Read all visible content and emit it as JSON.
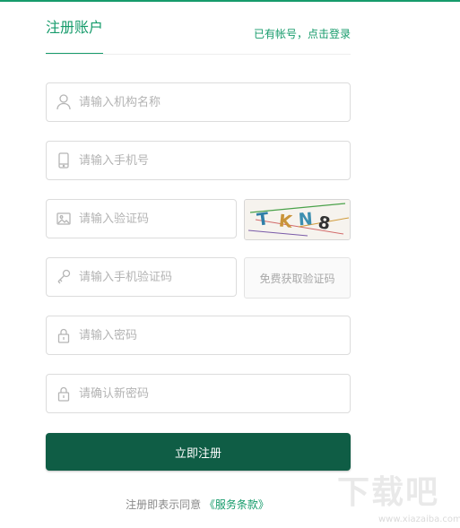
{
  "header": {
    "tab_title": "注册账户",
    "login_link": "已有帐号，点击登录"
  },
  "form": {
    "org_name": {
      "placeholder": "请输入机构名称",
      "icon": "user-icon"
    },
    "phone": {
      "placeholder": "请输入手机号",
      "icon": "phone-icon"
    },
    "captcha": {
      "placeholder": "请输入验证码",
      "icon": "image-icon",
      "image_text": "TKN8"
    },
    "sms_code": {
      "placeholder": "请输入手机验证码",
      "icon": "key-icon",
      "button_label": "免费获取验证码"
    },
    "password": {
      "placeholder": "请输入密码",
      "icon": "lock-icon"
    },
    "password_confirm": {
      "placeholder": "请确认新密码",
      "icon": "lock-icon"
    },
    "submit_label": "立即注册"
  },
  "terms": {
    "prefix": "注册即表示同意",
    "link": "《服务条款》"
  },
  "watermark": {
    "main": "下载吧",
    "url": "www.xiazaiba.com"
  },
  "colors": {
    "accent": "#169b6b",
    "submit_bg": "#0f5d45",
    "border": "#dcdcdc",
    "placeholder": "#b3b3b3"
  }
}
